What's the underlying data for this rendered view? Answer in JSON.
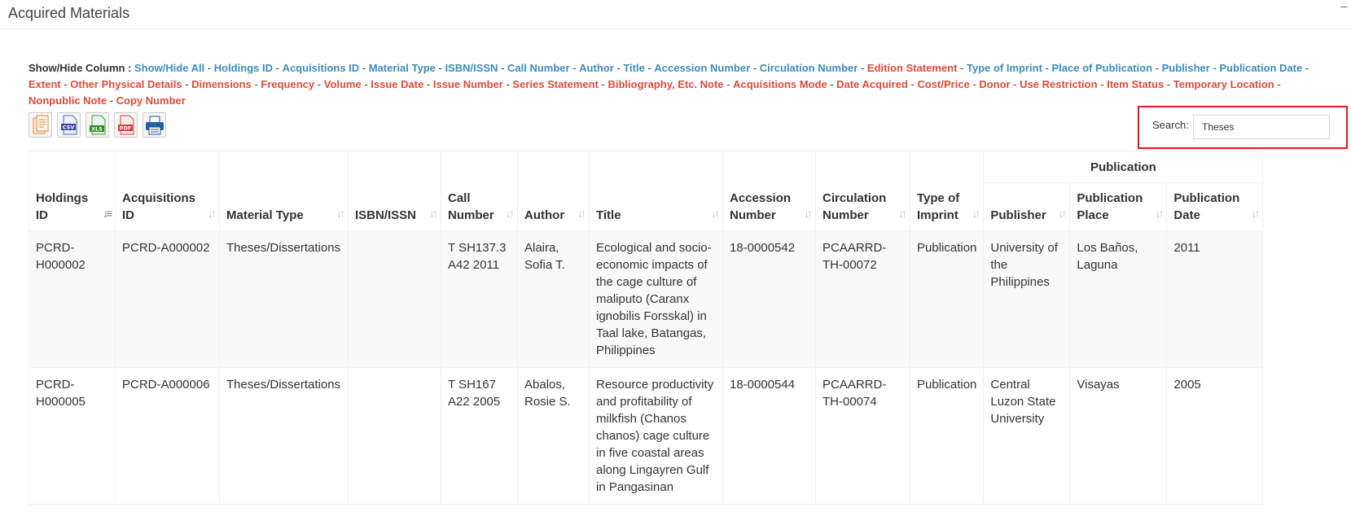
{
  "panel": {
    "title": "Acquired Materials",
    "collapse_icon": "−"
  },
  "colvis": {
    "label": "Show/Hide Column :",
    "columns": [
      {
        "label": "Show/Hide All",
        "visible": true
      },
      {
        "label": "Holdings ID",
        "visible": true
      },
      {
        "label": "Acquisitions ID",
        "visible": true
      },
      {
        "label": "Material Type",
        "visible": true
      },
      {
        "label": "ISBN/ISSN",
        "visible": true
      },
      {
        "label": "Call Number",
        "visible": true
      },
      {
        "label": "Author",
        "visible": true
      },
      {
        "label": "Title",
        "visible": true
      },
      {
        "label": "Accession Number",
        "visible": true
      },
      {
        "label": "Circulation Number",
        "visible": true
      },
      {
        "label": "Edition Statement",
        "visible": false
      },
      {
        "label": "Type of Imprint",
        "visible": true
      },
      {
        "label": "Place of Publication",
        "visible": true
      },
      {
        "label": "Publisher",
        "visible": true
      },
      {
        "label": "Publication Date",
        "visible": true
      },
      {
        "label": "Extent",
        "visible": false
      },
      {
        "label": "Other Physical Details",
        "visible": false
      },
      {
        "label": "Dimensions",
        "visible": false
      },
      {
        "label": "Frequency",
        "visible": false
      },
      {
        "label": "Volume",
        "visible": false
      },
      {
        "label": "Issue Date",
        "visible": false
      },
      {
        "label": "Issue Number",
        "visible": false
      },
      {
        "label": "Series Statement",
        "visible": false
      },
      {
        "label": "Bibliography, Etc. Note",
        "visible": false
      },
      {
        "label": "Acquisitions Mode",
        "visible": false
      },
      {
        "label": "Date Acquired",
        "visible": false
      },
      {
        "label": "Cost/Price",
        "visible": false
      },
      {
        "label": "Donor",
        "visible": false
      },
      {
        "label": "Use Restriction",
        "visible": false
      },
      {
        "label": "Item Status",
        "visible": false
      },
      {
        "label": "Temporary Location",
        "visible": false
      },
      {
        "label": "Nonpublic Note",
        "visible": false
      },
      {
        "label": "Copy Number",
        "visible": false
      }
    ],
    "colors": {
      "visible": "#3c8dbc",
      "hidden": "#dd4b39"
    }
  },
  "export": {
    "buttons": [
      {
        "name": "copy",
        "icon": "copy-icon",
        "label": ""
      },
      {
        "name": "csv",
        "icon": "csv-file-icon",
        "label": "CSV"
      },
      {
        "name": "excel",
        "icon": "xls-file-icon",
        "label": "XLS"
      },
      {
        "name": "pdf",
        "icon": "pdf-file-icon",
        "label": "PDF"
      },
      {
        "name": "print",
        "icon": "printer-icon",
        "label": ""
      }
    ]
  },
  "search": {
    "label": "Search:",
    "value": "Theses",
    "highlight_color": "#e0161c"
  },
  "table": {
    "group_header": "Publication",
    "headers": {
      "holdings_id": "Holdings ID",
      "acquisitions_id": "Acquisitions ID",
      "material_type": "Material Type",
      "isbn_issn": "ISBN/ISSN",
      "call_number": "Call Number",
      "author": "Author",
      "title": "Title",
      "accession_number": "Accession Number",
      "circulation_number": "Circulation Number",
      "type_of_imprint": "Type of Imprint",
      "publisher": "Publisher",
      "publication_place": "Publication Place",
      "publication_date": "Publication Date"
    },
    "sorted_column": "holdings_id",
    "rows": [
      {
        "holdings_id": "PCRD-H000002",
        "acquisitions_id": "PCRD-A000002",
        "material_type": "Theses/Dissertations",
        "isbn_issn": "",
        "call_number": "T SH137.3 A42 2011",
        "author": "Alaira, Sofia T.",
        "title": "Ecological and socio-economic impacts of the cage culture of maliputo (Caranx ignobilis Forsskal) in Taal lake, Batangas, Philippines",
        "accession_number": "18-0000542",
        "circulation_number": "PCAARRD-TH-00072",
        "type_of_imprint": "Publication",
        "publisher": "University of the Philippines",
        "publication_place": "Los Baños, Laguna",
        "publication_date": "2011"
      },
      {
        "holdings_id": "PCRD-H000005",
        "acquisitions_id": "PCRD-A000006",
        "material_type": "Theses/Dissertations",
        "isbn_issn": "",
        "call_number": "T SH167 A22 2005",
        "author": "Abalos, Rosie S.",
        "title": "Resource productivity and profitability of milkfish (Chanos chanos) cage culture in five coastal areas along Lingayren Gulf in Pangasinan",
        "accession_number": "18-0000544",
        "circulation_number": "PCAARRD-TH-00074",
        "type_of_imprint": "Publication",
        "publisher": "Central Luzon State University",
        "publication_place": "Visayas",
        "publication_date": "2005"
      }
    ]
  }
}
